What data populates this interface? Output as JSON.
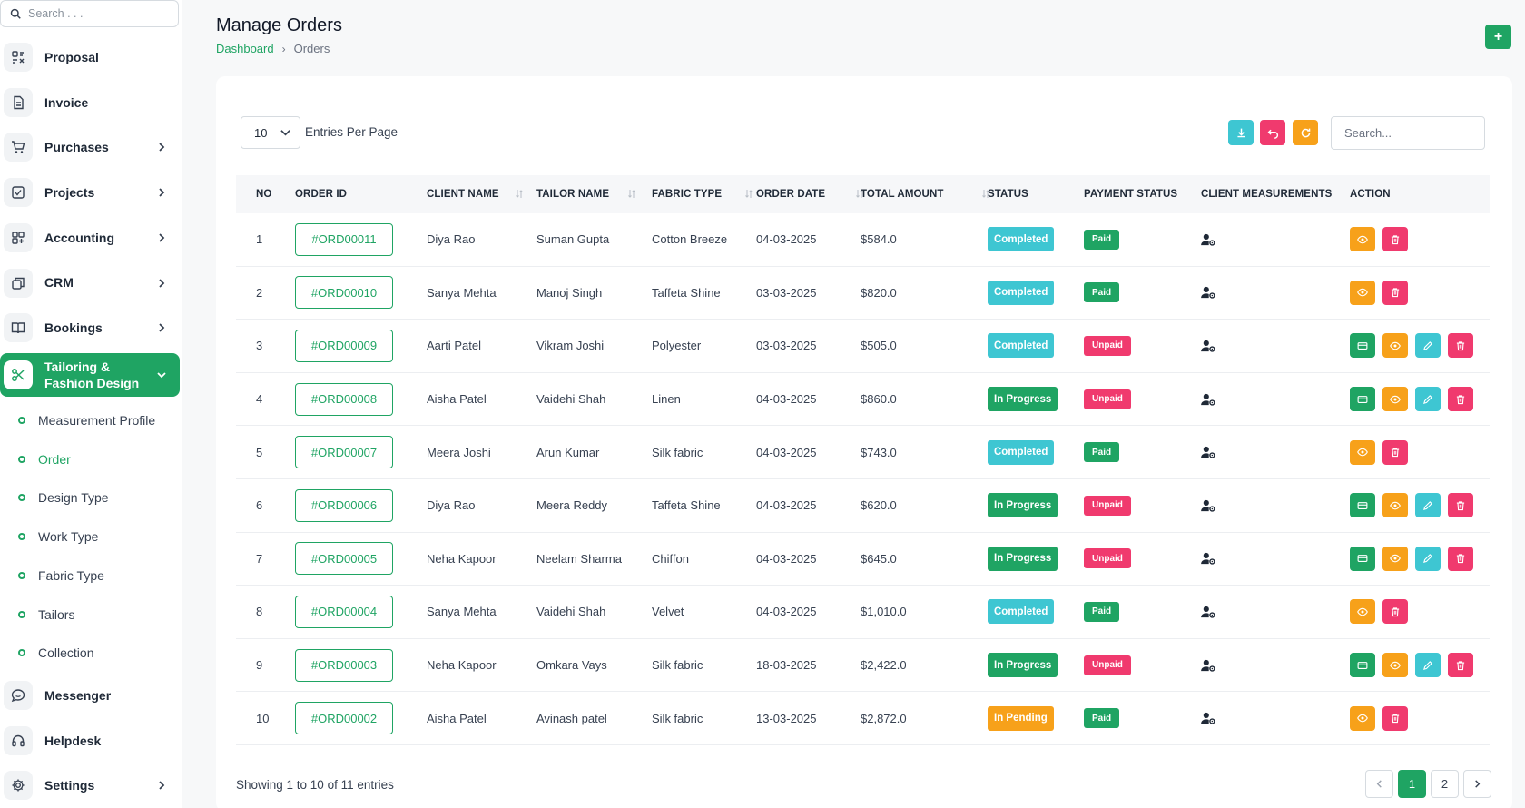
{
  "colors": {
    "accent": "#1fa463",
    "completed": "#3ec6d2",
    "in_progress": "#1fa463",
    "pending": "#f7a11a",
    "paid": "#1fa463",
    "unpaid": "#f03a6e",
    "view": "#f7a11a",
    "delete": "#f03a6e",
    "edit": "#3ec6d2",
    "payment": "#1fa463"
  },
  "sidebar": {
    "search_placeholder": "Search . . .",
    "items": [
      {
        "label": "Proposal",
        "icon": "proposal-icon",
        "chevron": false
      },
      {
        "label": "Invoice",
        "icon": "invoice-icon",
        "chevron": false
      },
      {
        "label": "Purchases",
        "icon": "cart-icon",
        "chevron": true
      },
      {
        "label": "Projects",
        "icon": "checkbox-icon",
        "chevron": true
      },
      {
        "label": "Accounting",
        "icon": "grid-icon",
        "chevron": true
      },
      {
        "label": "CRM",
        "icon": "layers-icon",
        "chevron": true
      },
      {
        "label": "Bookings",
        "icon": "book-icon",
        "chevron": true
      }
    ],
    "active": {
      "label": "Tailoring & Fashion Design",
      "icon": "scissors-icon"
    },
    "sub_items": [
      "Measurement Profile",
      "Order",
      "Design Type",
      "Work Type",
      "Fabric Type",
      "Tailors",
      "Collection"
    ],
    "bottom_items": [
      {
        "label": "Messenger",
        "icon": "message-icon",
        "chevron": false
      },
      {
        "label": "Helpdesk",
        "icon": "headset-icon",
        "chevron": false
      },
      {
        "label": "Settings",
        "icon": "gear-icon",
        "chevron": true
      }
    ]
  },
  "header": {
    "title": "Manage Orders",
    "breadcrumb": {
      "home": "Dashboard",
      "current": "Orders"
    },
    "add_label": "+"
  },
  "controls": {
    "per_page_value": "10",
    "per_page_label": "Entries Per Page",
    "search_placeholder": "Search..."
  },
  "table": {
    "headers": [
      "NO",
      "ORDER ID",
      "CLIENT NAME",
      "TAILOR NAME",
      "FABRIC TYPE",
      "ORDER DATE",
      "TOTAL AMOUNT",
      "STATUS",
      "PAYMENT STATUS",
      "CLIENT MEASUREMENTS",
      "ACTION"
    ],
    "rows": [
      {
        "no": "1",
        "order_id": "#ORD00011",
        "client": "Diya Rao",
        "tailor": "Suman Gupta",
        "fabric": "Cotton Breeze",
        "date": "04-03-2025",
        "amount": "$584.0",
        "status": "Completed",
        "payment": "Paid",
        "actions": [
          "view",
          "delete"
        ]
      },
      {
        "no": "2",
        "order_id": "#ORD00010",
        "client": "Sanya Mehta",
        "tailor": "Manoj Singh",
        "fabric": "Taffeta Shine",
        "date": "03-03-2025",
        "amount": "$820.0",
        "status": "Completed",
        "payment": "Paid",
        "actions": [
          "view",
          "delete"
        ]
      },
      {
        "no": "3",
        "order_id": "#ORD00009",
        "client": "Aarti Patel",
        "tailor": "Vikram Joshi",
        "fabric": "Polyester",
        "date": "03-03-2025",
        "amount": "$505.0",
        "status": "Completed",
        "payment": "Unpaid",
        "actions": [
          "payment",
          "view",
          "edit",
          "delete"
        ]
      },
      {
        "no": "4",
        "order_id": "#ORD00008",
        "client": "Aisha Patel",
        "tailor": "Vaidehi Shah",
        "fabric": "Linen",
        "date": "04-03-2025",
        "amount": "$860.0",
        "status": "In Progress",
        "payment": "Unpaid",
        "actions": [
          "payment",
          "view",
          "edit",
          "delete"
        ]
      },
      {
        "no": "5",
        "order_id": "#ORD00007",
        "client": "Meera Joshi",
        "tailor": "Arun Kumar",
        "fabric": "Silk fabric",
        "date": "04-03-2025",
        "amount": "$743.0",
        "status": "Completed",
        "payment": "Paid",
        "actions": [
          "view",
          "delete"
        ]
      },
      {
        "no": "6",
        "order_id": "#ORD00006",
        "client": "Diya Rao",
        "tailor": "Meera Reddy",
        "fabric": "Taffeta Shine",
        "date": "04-03-2025",
        "amount": "$620.0",
        "status": "In Progress",
        "payment": "Unpaid",
        "actions": [
          "payment",
          "view",
          "edit",
          "delete"
        ]
      },
      {
        "no": "7",
        "order_id": "#ORD00005",
        "client": "Neha Kapoor",
        "tailor": "Neelam Sharma",
        "fabric": "Chiffon",
        "date": "04-03-2025",
        "amount": "$645.0",
        "status": "In Progress",
        "payment": "Unpaid",
        "actions": [
          "payment",
          "view",
          "edit",
          "delete"
        ]
      },
      {
        "no": "8",
        "order_id": "#ORD00004",
        "client": "Sanya Mehta",
        "tailor": "Vaidehi Shah",
        "fabric": "Velvet",
        "date": "04-03-2025",
        "amount": "$1,010.0",
        "status": "Completed",
        "payment": "Paid",
        "actions": [
          "view",
          "delete"
        ]
      },
      {
        "no": "9",
        "order_id": "#ORD00003",
        "client": "Neha Kapoor",
        "tailor": "Omkara Vays",
        "fabric": "Silk fabric",
        "date": "18-03-2025",
        "amount": "$2,422.0",
        "status": "In Progress",
        "payment": "Unpaid",
        "actions": [
          "payment",
          "view",
          "edit",
          "delete"
        ]
      },
      {
        "no": "10",
        "order_id": "#ORD00002",
        "client": "Aisha Patel",
        "tailor": "Avinash patel",
        "fabric": "Silk fabric",
        "date": "13-03-2025",
        "amount": "$2,872.0",
        "status": "In Pending",
        "payment": "Paid",
        "actions": [
          "view",
          "delete"
        ]
      }
    ]
  },
  "footer": {
    "showing": "Showing 1 to 10 of 11 entries",
    "pages": [
      "1",
      "2"
    ]
  }
}
